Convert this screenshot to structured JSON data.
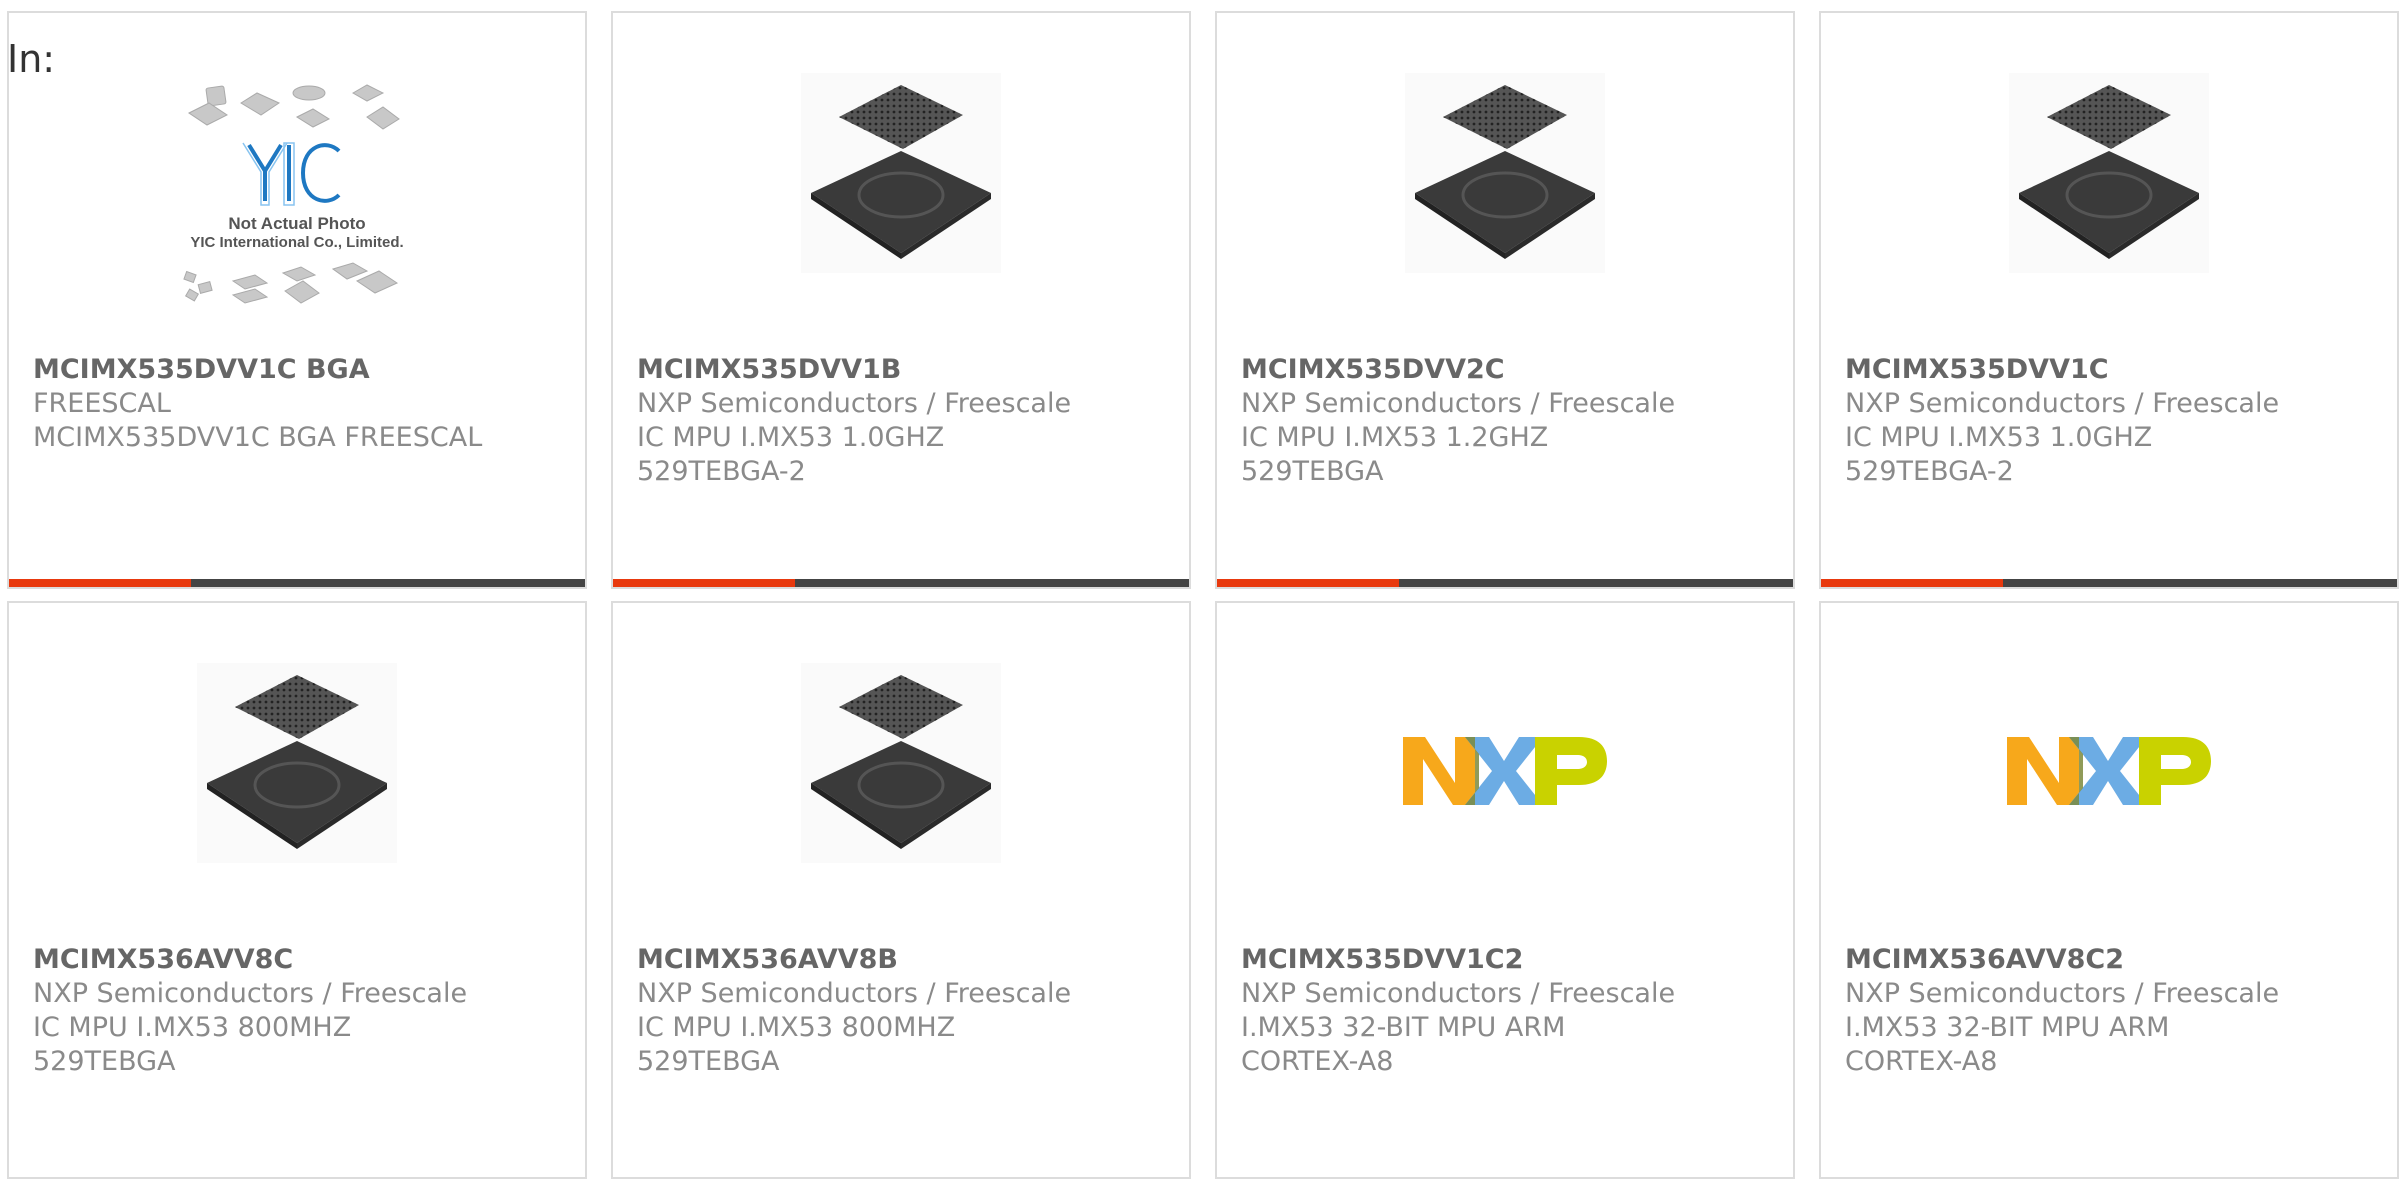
{
  "filter_label": "In:",
  "colors": {
    "accent": "#e8390e",
    "bar_dark": "#444444",
    "card_border": "#dcdcdc",
    "title_text": "#666666",
    "body_text": "#8a8a8a",
    "nxp_orange": "#f7a81b",
    "nxp_blue": "#6cace4",
    "nxp_green": "#c9d200"
  },
  "products": [
    {
      "image_type": "placeholder-photo",
      "image_text": {
        "logo": "YIC",
        "caption_line1": "Not Actual Photo",
        "caption_line2": "YIC International Co., Limited."
      },
      "title": "MCIMX535DVV1C BGA",
      "lines": [
        "FREESCAL",
        "MCIMX535DVV1C BGA FREESCAL"
      ]
    },
    {
      "image_type": "bga-chip",
      "title": "MCIMX535DVV1B",
      "lines": [
        "NXP Semiconductors / Freescale",
        "IC MPU I.MX53 1.0GHZ",
        "529TEBGA-2"
      ]
    },
    {
      "image_type": "bga-chip",
      "title": "MCIMX535DVV2C",
      "lines": [
        "NXP Semiconductors / Freescale",
        "IC MPU I.MX53 1.2GHZ",
        "529TEBGA"
      ]
    },
    {
      "image_type": "bga-chip",
      "title": "MCIMX535DVV1C",
      "lines": [
        "NXP Semiconductors / Freescale",
        "IC MPU I.MX53 1.0GHZ",
        "529TEBGA-2"
      ]
    },
    {
      "image_type": "bga-chip",
      "title": "MCIMX536AVV8C",
      "lines": [
        "NXP Semiconductors / Freescale",
        "IC MPU I.MX53 800MHZ",
        "529TEBGA"
      ]
    },
    {
      "image_type": "bga-chip",
      "title": "MCIMX536AVV8B",
      "lines": [
        "NXP Semiconductors / Freescale",
        "IC MPU I.MX53 800MHZ",
        "529TEBGA"
      ]
    },
    {
      "image_type": "nxp-logo",
      "title": "MCIMX535DVV1C2",
      "lines": [
        "NXP Semiconductors / Freescale",
        "I.MX53 32-BIT MPU ARM",
        "CORTEX-A8"
      ]
    },
    {
      "image_type": "nxp-logo",
      "title": "MCIMX536AVV8C2",
      "lines": [
        "NXP Semiconductors / Freescale",
        "I.MX53 32-BIT MPU ARM",
        "CORTEX-A8"
      ]
    }
  ]
}
